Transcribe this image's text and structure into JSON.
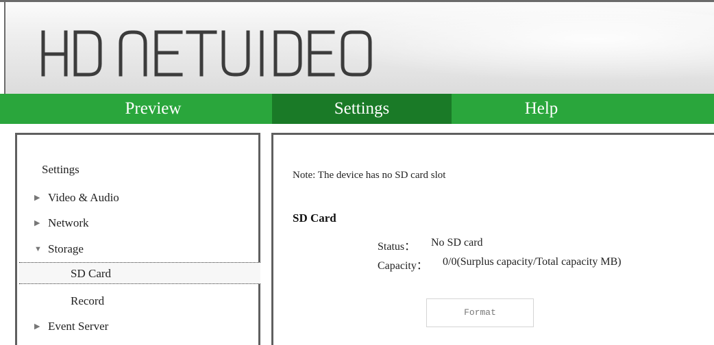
{
  "header": {
    "logo_text": "HD NETVIDEO"
  },
  "nav": {
    "items": [
      {
        "label": "Preview"
      },
      {
        "label": "Settings"
      },
      {
        "label": "Help"
      }
    ],
    "active": "Settings"
  },
  "sidebar": {
    "title": "Settings",
    "items": [
      {
        "label": "Video & Audio",
        "icon": "triangle-right-icon"
      },
      {
        "label": "Network",
        "icon": "triangle-right-icon"
      },
      {
        "label": "Storage",
        "icon": "triangle-down-icon"
      },
      {
        "label": "Event Server",
        "icon": "triangle-right-icon"
      }
    ],
    "storage_sub": [
      {
        "label": "SD Card"
      },
      {
        "label": "Record"
      }
    ],
    "selected": "SD Card"
  },
  "content": {
    "note": "Note: The device has no SD card slot",
    "section_title": "SD Card",
    "status_label": "Status：",
    "status_value": "No SD card",
    "capacity_label": "Capacity：",
    "capacity_value": "0/0(Surplus capacity/Total capacity MB)",
    "format_label": "Format"
  },
  "colors": {
    "nav_green": "#2aa63c",
    "nav_active": "#1a7a27",
    "border": "#5f5f5f"
  }
}
